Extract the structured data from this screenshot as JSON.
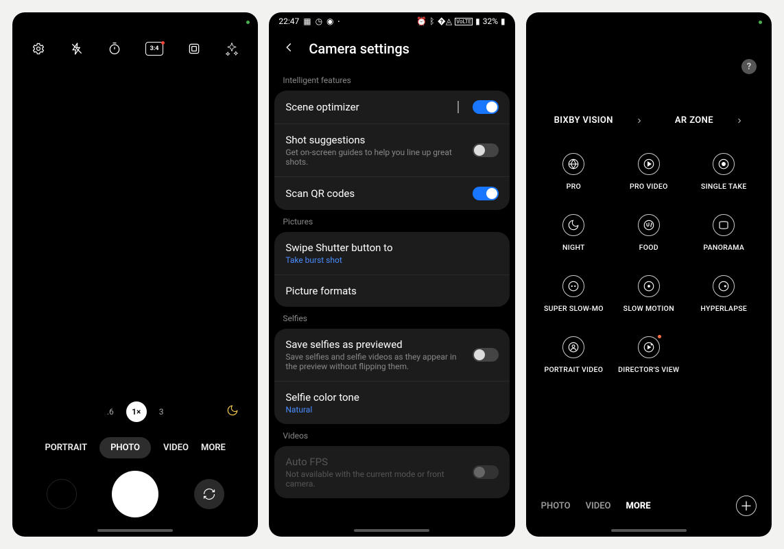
{
  "screen1": {
    "toolbar_icons": [
      "gear-icon",
      "flash-icon",
      "timer-icon",
      "ratio-icon",
      "motion-photo-icon",
      "filters-icon"
    ],
    "ratio_label": "3:4",
    "zoom": {
      "low": ".6",
      "mid": "1×",
      "high": "3"
    },
    "modes": {
      "portrait": "PORTRAIT",
      "photo": "PHOTO",
      "video": "VIDEO",
      "more": "MORE"
    }
  },
  "screen2": {
    "status": {
      "time": "22:47",
      "battery": "32%"
    },
    "header_title": "Camera settings",
    "sections": {
      "intelligent": {
        "label": "Intelligent features",
        "scene_optimizer": "Scene optimizer",
        "shot_suggestions_title": "Shot suggestions",
        "shot_suggestions_sub": "Get on-screen guides to help you line up great shots.",
        "scan_qr": "Scan QR codes"
      },
      "pictures": {
        "label": "Pictures",
        "swipe_title": "Swipe Shutter button to",
        "swipe_sub": "Take burst shot",
        "formats": "Picture formats"
      },
      "selfies": {
        "label": "Selfies",
        "save_title": "Save selfies as previewed",
        "save_sub": "Save selfies and selfie videos as they appear in the preview without flipping them.",
        "tone_title": "Selfie color tone",
        "tone_sub": "Natural"
      },
      "videos": {
        "label": "Videos",
        "autofps_title": "Auto FPS",
        "autofps_sub": "Not available with the current mode or front camera."
      }
    },
    "toggles": {
      "scene_optimizer": true,
      "shot_suggestions": false,
      "scan_qr": true,
      "save_selfies": false,
      "autofps": false
    }
  },
  "screen3": {
    "links": {
      "bixby": "BIXBY VISION",
      "ar": "AR ZONE"
    },
    "grid": [
      {
        "label": "PRO",
        "icon": "aperture"
      },
      {
        "label": "PRO VIDEO",
        "icon": "play-circle"
      },
      {
        "label": "SINGLE TAKE",
        "icon": "target"
      },
      {
        "label": "NIGHT",
        "icon": "moon"
      },
      {
        "label": "FOOD",
        "icon": "food"
      },
      {
        "label": "PANORAMA",
        "icon": "panorama"
      },
      {
        "label": "SUPER SLOW-MO",
        "icon": "slow"
      },
      {
        "label": "SLOW MOTION",
        "icon": "dot-circle"
      },
      {
        "label": "HYPERLAPSE",
        "icon": "hyperlapse"
      },
      {
        "label": "PORTRAIT VIDEO",
        "icon": "portrait-video"
      },
      {
        "label": "DIRECTOR'S VIEW",
        "icon": "director",
        "badge": true
      }
    ],
    "bottom_modes": {
      "photo": "PHOTO",
      "video": "VIDEO",
      "more": "MORE"
    }
  }
}
